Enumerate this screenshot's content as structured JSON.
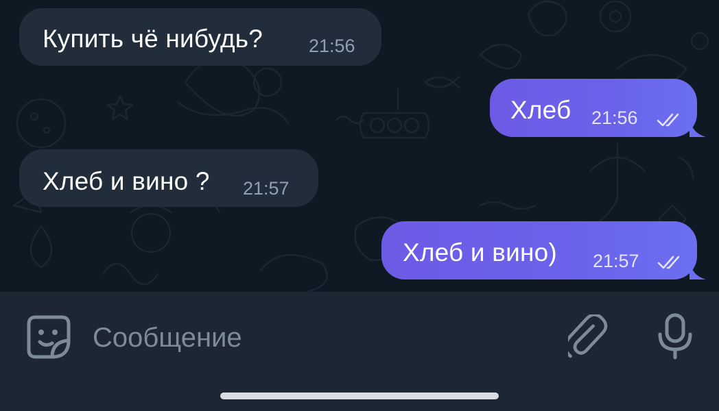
{
  "messages": [
    {
      "direction": "incoming",
      "text": "Купить чё нибудь?",
      "time": "21:56"
    },
    {
      "direction": "outgoing",
      "text": "Хлеб",
      "time": "21:56",
      "status": "read"
    },
    {
      "direction": "incoming",
      "text": "Хлеб и вино ?",
      "time": "21:57"
    },
    {
      "direction": "outgoing",
      "text": "Хлеб и вино)",
      "time": "21:57",
      "status": "read"
    }
  ],
  "composer": {
    "placeholder": "Сообщение",
    "sticker_icon": "sticker-smile-icon",
    "attach_icon": "paperclip-icon",
    "voice_icon": "microphone-icon"
  },
  "colors": {
    "chat_background": "#0f1923",
    "incoming_bubble": "#212d3b",
    "outgoing_bubble": "#6b63ea",
    "composer_background": "#1d2733",
    "placeholder_text": "#7c8a99"
  }
}
